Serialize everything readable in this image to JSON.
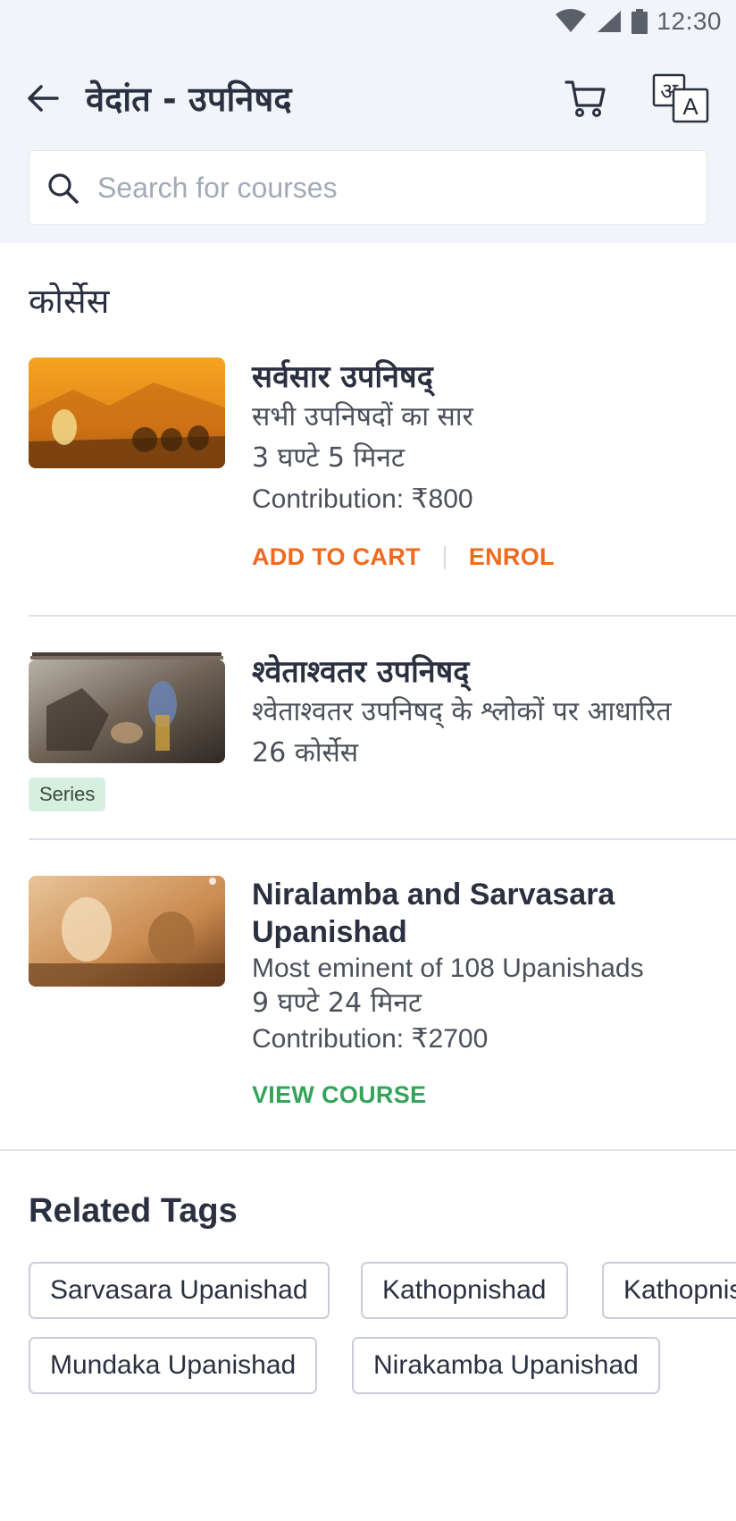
{
  "status_bar": {
    "time": "12:30",
    "icons": [
      "wifi-icon",
      "signal-icon",
      "battery-icon"
    ]
  },
  "app_bar": {
    "title": "वेदांत - उपनिषद",
    "icons": [
      "back-arrow-icon",
      "cart-icon",
      "translate-icon"
    ]
  },
  "search": {
    "placeholder": "Search for courses",
    "value": ""
  },
  "section_title": "कोर्सेस",
  "courses": [
    {
      "title": "सर्वसार उपनिषद्",
      "subtitle": "सभी उपनिषदों का सार",
      "duration": "3 घण्टे 5 मिनट",
      "price": "Contribution: ₹800",
      "actions": [
        "ADD TO CART",
        "ENROL"
      ]
    },
    {
      "title": "श्वेताश्वतर उपनिषद्",
      "subtitle": "श्वेताश्वतर उपनिषद् के श्लोकों पर आधारित",
      "count": "26 कोर्सेस",
      "badge": "Series"
    },
    {
      "title": "Niralamba and Sarvasara Upanishad",
      "subtitle": "Most eminent of 108 Upanishads",
      "duration": "9 घण्टे 24 मिनट",
      "price": "Contribution: ₹2700",
      "actions": [
        "VIEW COURSE"
      ]
    }
  ],
  "related": {
    "title": "Related Tags",
    "tags": [
      "Sarvasara Upanishad",
      "Kathopnishad",
      "Kathopnishad",
      "Mundaka Upanishad",
      "Nirakamba Upanishad"
    ]
  },
  "colors": {
    "header_bg": "#f1f5fa",
    "accent_orange": "#f06a1e",
    "accent_green": "#35a45a",
    "series_badge_bg": "#d7efe0"
  }
}
